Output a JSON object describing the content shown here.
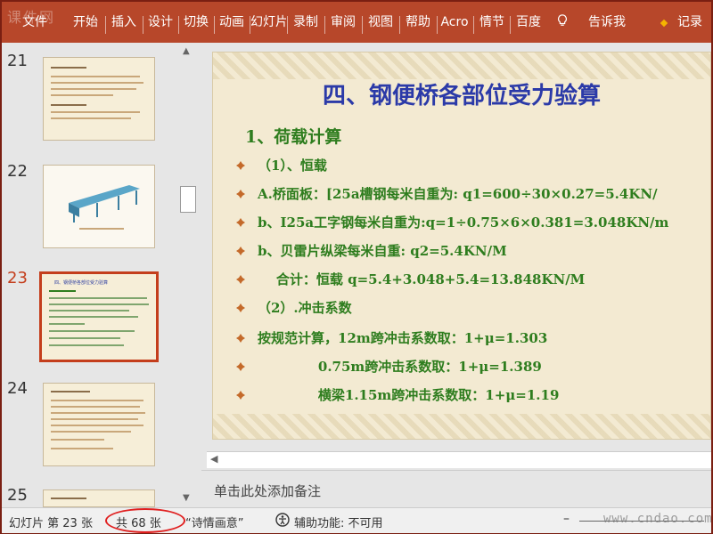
{
  "ribbon": {
    "tabs": [
      "文件",
      "开始",
      "插入",
      "设计",
      "切换",
      "动画",
      "幻灯片",
      "录制",
      "审阅",
      "视图",
      "帮助",
      "Acro",
      "情节",
      "百度",
      "告诉我",
      "记录"
    ],
    "watermark": "课件网"
  },
  "thumbnails": [
    {
      "number": "21",
      "title": "",
      "active": false
    },
    {
      "number": "22",
      "title": "",
      "active": false
    },
    {
      "number": "23",
      "title": "四、钢便桥各部位受力验算",
      "active": true
    },
    {
      "number": "24",
      "title": "",
      "active": false
    },
    {
      "number": "25",
      "title": "",
      "active": false
    }
  ],
  "slide": {
    "title": "四、钢便桥各部位受力验算",
    "heading": "1、荷载计算",
    "lines": [
      "（1）、恒载",
      "A.桥面板：[25a槽钢每米自重为: q1=600÷30×0.27=5.4KN/",
      "b、I25a工字钢每米自重为:q=1÷0.75×6×0.381=3.048KN/m",
      "b、贝雷片纵梁每米自重:  q2=5.4KN/M",
      "    合计：恒载 q=5.4+3.048+5.4=13.848KN/M",
      "（2）.冲击系数",
      "按规范计算，12m跨冲击系数取：1+μ=1.303",
      "             0.75m跨冲击系数取：1+μ=1.389",
      "             横梁1.15m跨冲击系数取：1+μ=1.19"
    ]
  },
  "notes": {
    "placeholder": "单击此处添加备注"
  },
  "status": {
    "slide_pos": "幻灯片 第 23 张",
    "slide_total": "共 68 张",
    "theme": "“诗情画意”",
    "accessibility": "辅助功能: 不可用",
    "zoom_minus": "–",
    "watermark": "www.cndao.com"
  },
  "colors": {
    "ribbon": "#b7472a",
    "accent": "#c43e1c",
    "title": "#2b3aa8",
    "body": "#2e7d1e",
    "annotation": "#e02020"
  }
}
